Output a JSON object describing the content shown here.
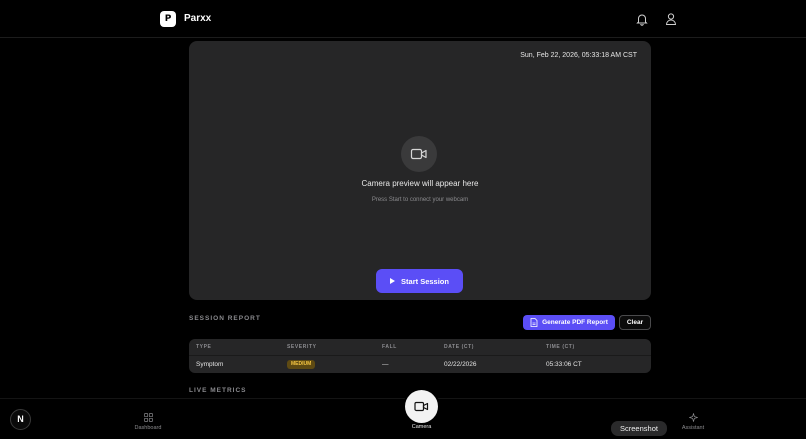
{
  "header": {
    "logo_text": "P",
    "app_name": "Parxx",
    "icons": [
      "bell-icon",
      "user-icon"
    ]
  },
  "camera": {
    "timestamp": "Sun, Feb 22, 2026, 05:33:18 AM CST",
    "preview_title": "Camera preview will appear here",
    "preview_subtitle": "Press Start to connect your webcam",
    "start_label": "Start Session"
  },
  "report": {
    "title": "SESSION REPORT",
    "pdf_label": "Generate PDF Report",
    "clear_label": "Clear",
    "columns": [
      "TYPE",
      "SEVERITY",
      "FALL",
      "DATE (CT)",
      "TIME (CT)"
    ],
    "rows": [
      {
        "type": "Symptom",
        "severity": "MEDIUM",
        "fall": "—",
        "date": "02/22/2026",
        "time": "05:33:06 CT"
      }
    ]
  },
  "metrics": {
    "title": "LIVE METRICS"
  },
  "nav": {
    "avatar_letter": "N",
    "dashboard_label": "Dashboard",
    "camera_label": "Camera",
    "assistant_label": "Assistant",
    "tooltip": "Screenshot"
  },
  "colors": {
    "accent": "#5b4ef6",
    "panel": "#262627",
    "badge_bg": "#5e4a13",
    "badge_text": "#f4c542"
  }
}
